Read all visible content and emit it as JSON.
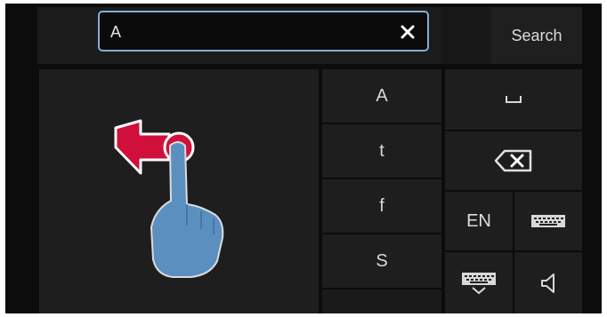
{
  "search": {
    "value": "A",
    "button_label": "Search"
  },
  "suggestions": [
    "A",
    "t",
    "f",
    "S"
  ],
  "keys": {
    "language_label": "EN"
  },
  "icons": {
    "clear": "close-icon",
    "space": "space-bar-icon",
    "backspace": "backspace-icon",
    "keyboard": "keyboard-icon",
    "hide_keyboard": "hide-keyboard-icon",
    "sound": "speaker-icon",
    "gesture": "swipe-left-gesture-icon"
  },
  "colors": {
    "accent": "#d0103a",
    "hand": "#5b8fbf",
    "field_border": "#7fb0d6"
  }
}
